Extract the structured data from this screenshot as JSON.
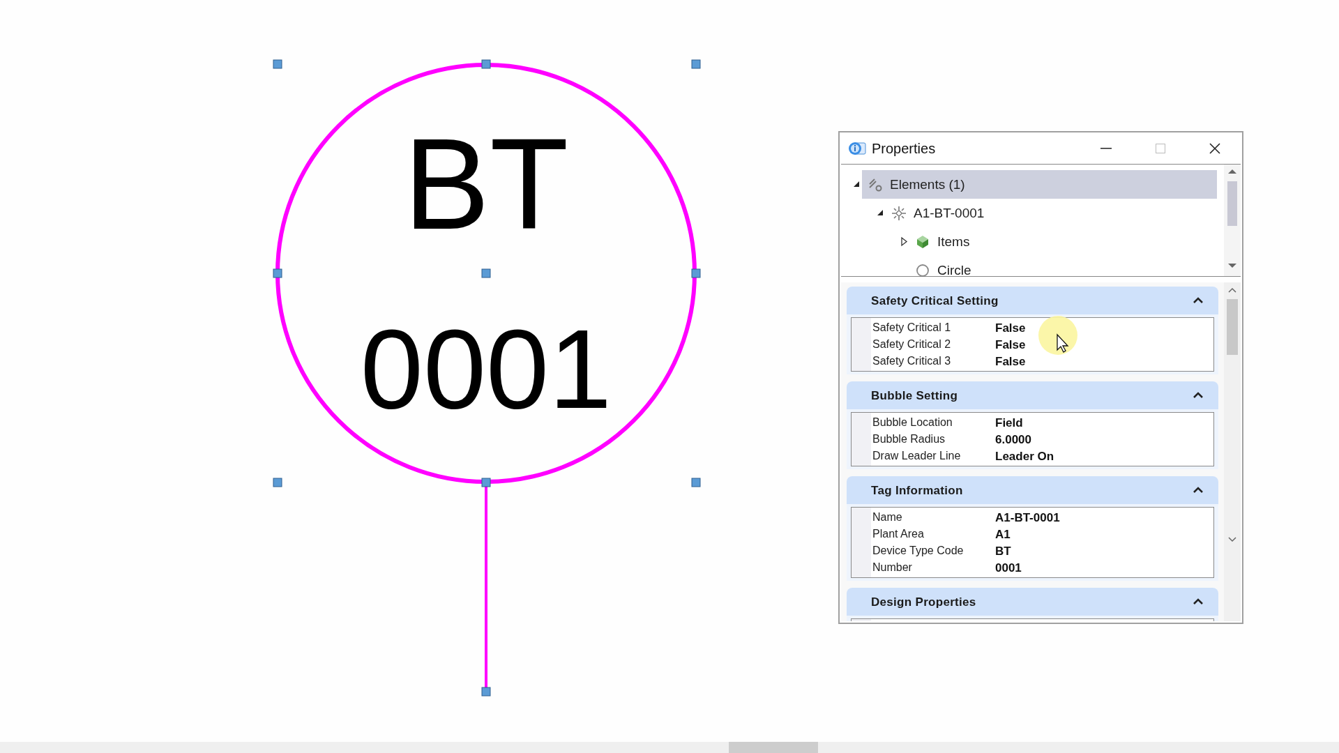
{
  "bubble": {
    "line_1": "BT",
    "line_2": "0001"
  },
  "window": {
    "title": "Properties"
  },
  "tree": [
    {
      "label": "Elements (1)",
      "kind": "elements",
      "expanded": true,
      "selected": true,
      "children": [
        {
          "label": "A1-BT-0001",
          "kind": "tag",
          "expanded": true,
          "selected": false,
          "children": [
            {
              "label": "Items",
              "kind": "items",
              "expanded": false,
              "selected": false
            },
            {
              "label": "Circle",
              "kind": "shape",
              "selected": false
            }
          ]
        }
      ]
    }
  ],
  "sections": [
    {
      "title": "Safety Critical Setting",
      "expanded": true,
      "rows": [
        {
          "label": "Safety Critical 1",
          "value": "False"
        },
        {
          "label": "Safety Critical 2",
          "value": "False"
        },
        {
          "label": "Safety Critical 3",
          "value": "False"
        }
      ]
    },
    {
      "title": "Bubble Setting",
      "expanded": true,
      "rows": [
        {
          "label": "Bubble Location",
          "value": "Field"
        },
        {
          "label": "Bubble Radius",
          "value": "6.0000"
        },
        {
          "label": "Draw Leader Line",
          "value": "Leader On"
        }
      ]
    },
    {
      "title": "Tag Information",
      "expanded": true,
      "rows": [
        {
          "label": "Name",
          "value": "A1-BT-0001"
        },
        {
          "label": "Plant Area",
          "value": "A1"
        },
        {
          "label": "Device Type Code",
          "value": "BT"
        },
        {
          "label": "Number",
          "value": "0001"
        }
      ]
    },
    {
      "title": "Design Properties",
      "expanded": true
    }
  ]
}
